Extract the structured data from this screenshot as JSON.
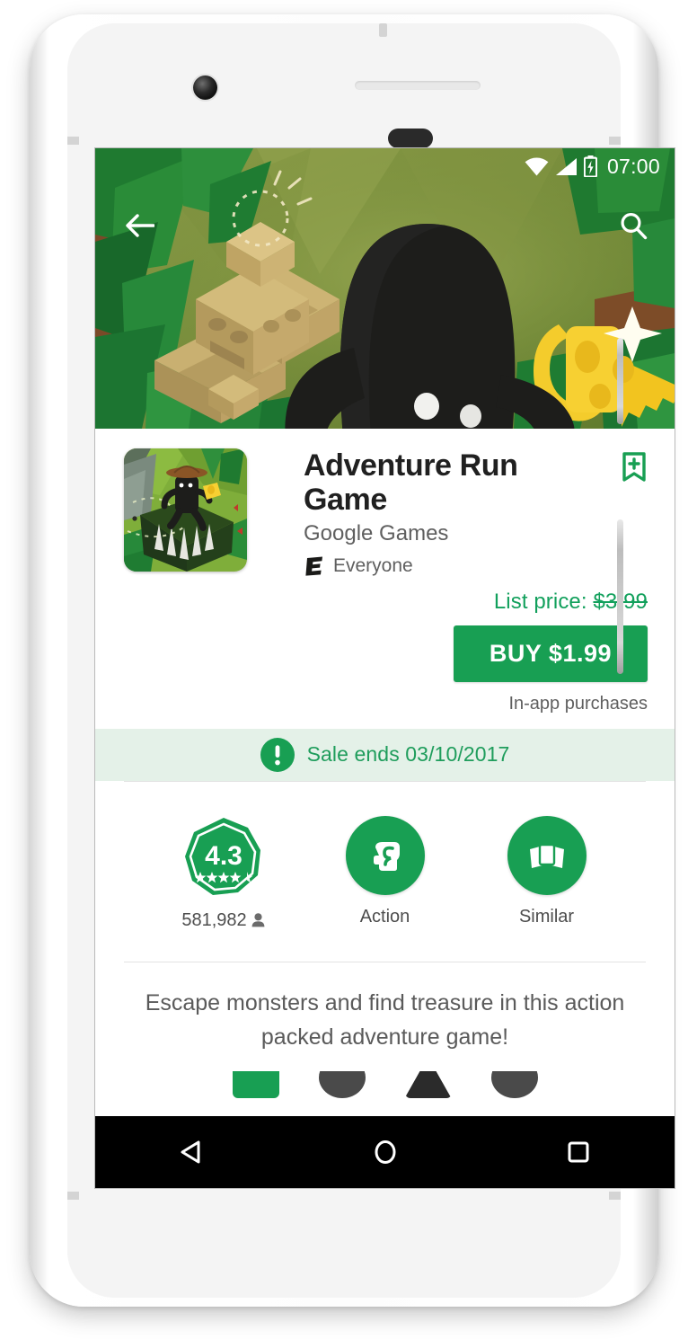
{
  "device": {
    "name": "white-android-phone",
    "front_camera": "camera-icon",
    "earpiece": "speaker-grille",
    "sensor": "proximity-sensor"
  },
  "status_bar": {
    "wifi_icon": "wifi-icon",
    "signal_icon": "cellular-signal-icon",
    "battery_icon": "battery-charging-icon",
    "clock": "07:00"
  },
  "hero": {
    "back_icon": "back-arrow-icon",
    "search_icon": "search-icon",
    "artwork": "jungle-adventure-banner"
  },
  "app": {
    "icon": "adventure-run-game-app-icon",
    "title": "Adventure Run Game",
    "developer": "Google Games",
    "content_rating_badge": "E",
    "content_rating": "Everyone",
    "wishlist_icon": "bookmark-add-icon"
  },
  "pricing": {
    "list_price_label": "List price:",
    "list_price_value": "$3.99",
    "buy_label": "BUY $1.99",
    "iap_note": "In-app purchases"
  },
  "sale_banner": {
    "icon": "alert-exclamation-icon",
    "text": "Sale ends 03/10/2017"
  },
  "stats": [
    {
      "name": "rating",
      "icon": "rating-octagon-badge",
      "value": "4.3",
      "stars": "★★★★",
      "caption": "581,982",
      "caption_icon": "person-icon"
    },
    {
      "name": "category",
      "icon": "action-fist-icon",
      "caption": "Action"
    },
    {
      "name": "similar",
      "icon": "similar-cards-icon",
      "caption": "Similar"
    }
  ],
  "description": {
    "text": "Escape monsters and find treasure in this action packed adventure game!"
  },
  "nav_bar": {
    "back": "nav-back-triangle-icon",
    "home": "nav-home-circle-icon",
    "recents": "nav-recents-square-icon"
  },
  "colors": {
    "green_primary": "#189f53",
    "green_text": "#12a05c",
    "sale_banner_bg": "#e4f1e8",
    "title_text": "#202020",
    "secondary_text": "#5f5f5f"
  }
}
